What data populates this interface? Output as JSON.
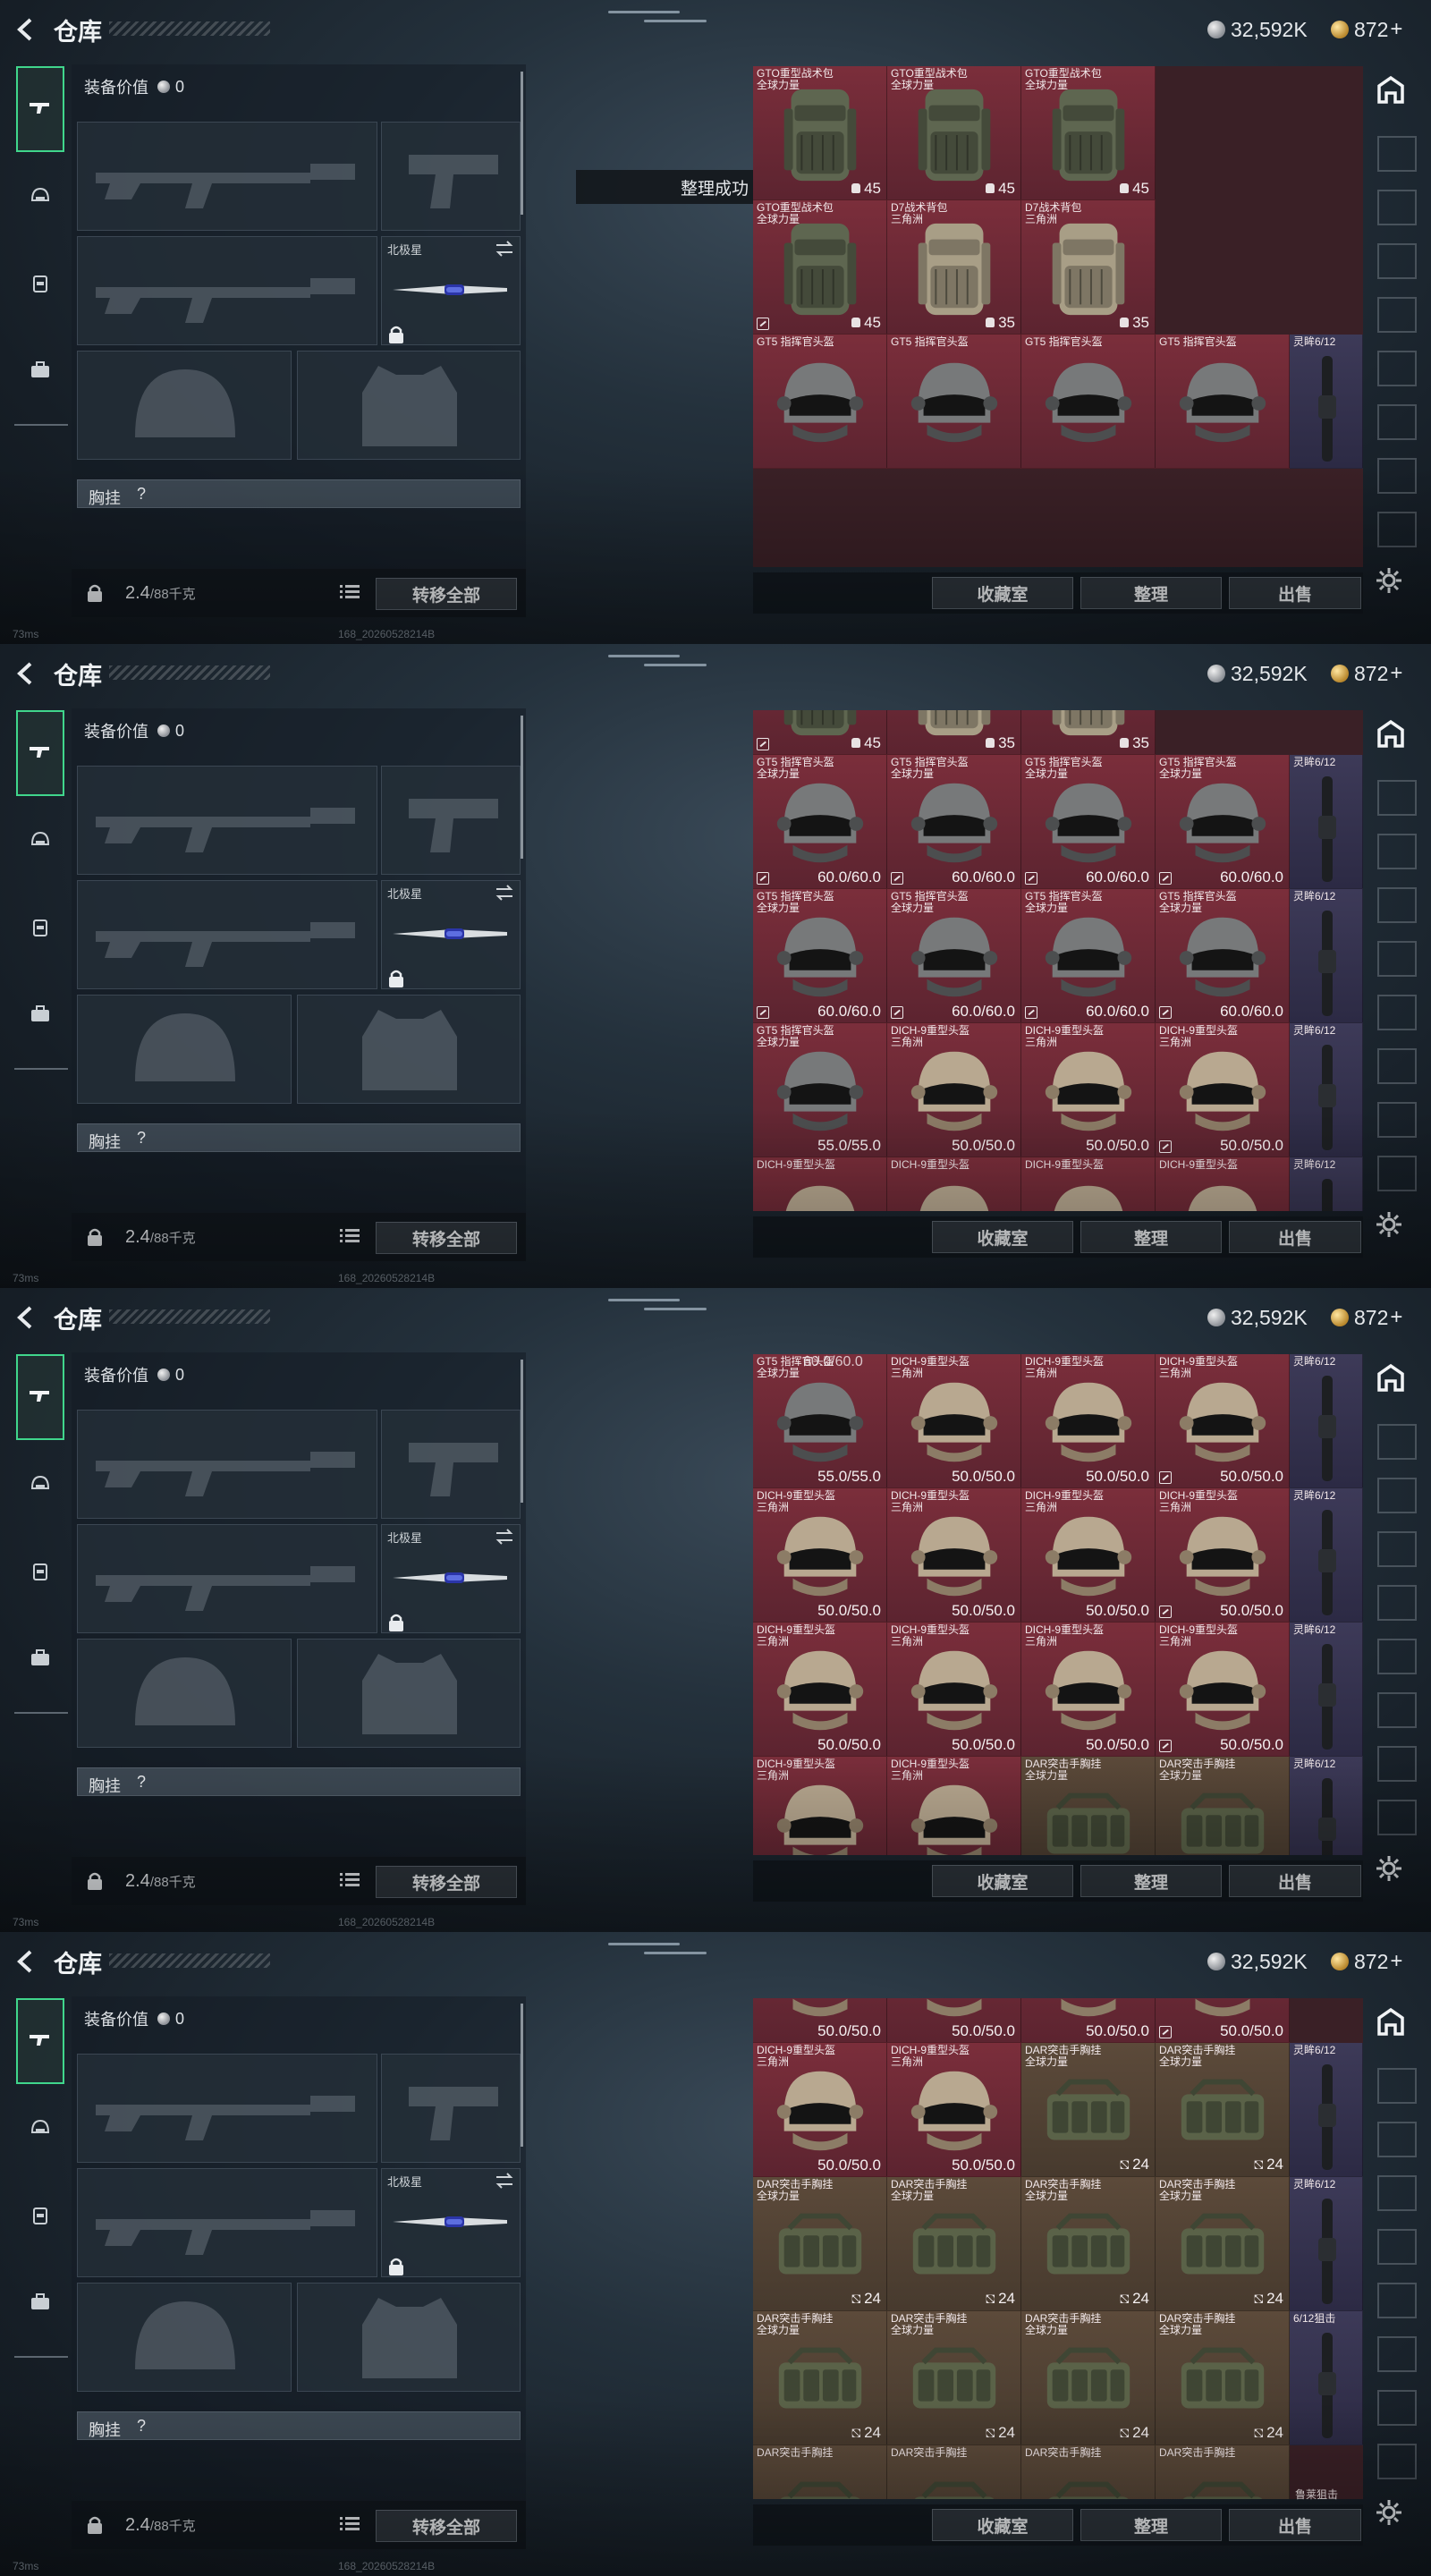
{
  "header": {
    "title": "仓库",
    "silver": "32,592K",
    "gold": "872",
    "gold_plus": "+"
  },
  "equipment": {
    "value_label": "装备价值",
    "value": "0",
    "melee_label": "北极星",
    "chest_label": "胸挂",
    "chest_q": "?",
    "weight": "2.4",
    "weight_cap": "/88千克",
    "transfer_all": "转移全部"
  },
  "toast": "整理成功",
  "actions": {
    "collection": "收藏室",
    "sort": "整理",
    "sell": "出售"
  },
  "status": {
    "ping": "73ms",
    "build": "168_20260528214B"
  },
  "frames": [
    {
      "cells": [
        {
          "r": 0,
          "c": 0,
          "name": "GTO重型战术包",
          "sub": "全球力量",
          "value": "45",
          "kind": "pack-green",
          "val": "cap"
        },
        {
          "r": 0,
          "c": 1,
          "name": "GTO重型战术包",
          "sub": "全球力量",
          "value": "45",
          "kind": "pack-green",
          "val": "cap"
        },
        {
          "r": 0,
          "c": 2,
          "name": "GTO重型战术包",
          "sub": "全球力量",
          "value": "45",
          "kind": "pack-green",
          "val": "cap"
        },
        {
          "r": 1,
          "c": 0,
          "name": "GTO重型战术包",
          "sub": "全球力量",
          "value": "45",
          "kind": "pack-green",
          "val": "cap",
          "tag": true
        },
        {
          "r": 1,
          "c": 1,
          "name": "D7战术背包",
          "sub": "三角洲",
          "value": "35",
          "kind": "pack-tan",
          "val": "cap"
        },
        {
          "r": 1,
          "c": 2,
          "name": "D7战术背包",
          "sub": "三角洲",
          "value": "35",
          "kind": "pack-tan",
          "val": "cap"
        },
        {
          "r": 2,
          "c": 0,
          "name": "GT5 指挥官头盔",
          "sub": "",
          "value": "",
          "kind": "helmet-grey",
          "val": "",
          "narrowCol": false
        },
        {
          "r": 2,
          "c": 1,
          "name": "GT5 指挥官头盔",
          "sub": "",
          "value": "",
          "kind": "helmet-grey",
          "val": ""
        },
        {
          "r": 2,
          "c": 2,
          "name": "GT5 指挥官头盔",
          "sub": "",
          "value": "",
          "kind": "helmet-grey",
          "val": ""
        },
        {
          "r": 2,
          "c": 3,
          "name": "GT5 指挥官头盔",
          "sub": "",
          "value": "",
          "kind": "helmet-grey",
          "val": ""
        }
      ],
      "narrow": [
        {
          "r": 2,
          "name": "灵眸6/12"
        }
      ],
      "offset": 0,
      "layout": "packs"
    },
    {
      "cells": [
        {
          "r": 0,
          "c": 0,
          "name": "",
          "sub": "",
          "value": "45",
          "kind": "pack-green",
          "val": "cap",
          "tag": true
        },
        {
          "r": 0,
          "c": 1,
          "name": "",
          "sub": "",
          "value": "35",
          "kind": "pack-tan",
          "val": "cap"
        },
        {
          "r": 0,
          "c": 2,
          "name": "",
          "sub": "",
          "value": "35",
          "kind": "pack-tan",
          "val": "cap"
        },
        {
          "r": 1,
          "c": 0,
          "name": "GT5 指挥官头盔",
          "sub": "全球力量",
          "value": "60.0/60.0",
          "kind": "helmet-grey",
          "tag": true
        },
        {
          "r": 1,
          "c": 1,
          "name": "GT5 指挥官头盔",
          "sub": "全球力量",
          "value": "60.0/60.0",
          "kind": "helmet-grey",
          "tag": true
        },
        {
          "r": 1,
          "c": 2,
          "name": "GT5 指挥官头盔",
          "sub": "全球力量",
          "value": "60.0/60.0",
          "kind": "helmet-grey",
          "tag": true
        },
        {
          "r": 1,
          "c": 3,
          "name": "GT5 指挥官头盔",
          "sub": "全球力量",
          "value": "60.0/60.0",
          "kind": "helmet-grey",
          "tag": true
        },
        {
          "r": 2,
          "c": 0,
          "name": "GT5 指挥官头盔",
          "sub": "全球力量",
          "value": "60.0/60.0",
          "kind": "helmet-grey",
          "tag": true
        },
        {
          "r": 2,
          "c": 1,
          "name": "GT5 指挥官头盔",
          "sub": "全球力量",
          "value": "60.0/60.0",
          "kind": "helmet-grey",
          "tag": true
        },
        {
          "r": 2,
          "c": 2,
          "name": "GT5 指挥官头盔",
          "sub": "全球力量",
          "value": "60.0/60.0",
          "kind": "helmet-grey",
          "tag": true
        },
        {
          "r": 2,
          "c": 3,
          "name": "GT5 指挥官头盔",
          "sub": "全球力量",
          "value": "60.0/60.0",
          "kind": "helmet-grey",
          "tag": true
        },
        {
          "r": 3,
          "c": 0,
          "name": "GT5 指挥官头盔",
          "sub": "全球力量",
          "value": "55.0/55.0",
          "kind": "helmet-grey"
        },
        {
          "r": 3,
          "c": 1,
          "name": "DICH-9重型头盔",
          "sub": "三角洲",
          "value": "50.0/50.0",
          "kind": "helmet-tan"
        },
        {
          "r": 3,
          "c": 2,
          "name": "DICH-9重型头盔",
          "sub": "三角洲",
          "value": "50.0/50.0",
          "kind": "helmet-tan"
        },
        {
          "r": 3,
          "c": 3,
          "name": "DICH-9重型头盔",
          "sub": "三角洲",
          "value": "50.0/50.0",
          "kind": "helmet-tan",
          "tag": true
        },
        {
          "r": 4,
          "c": 0,
          "name": "DICH-9重型头盔",
          "sub": "",
          "value": "",
          "kind": "helmet-tan"
        },
        {
          "r": 4,
          "c": 1,
          "name": "DICH-9重型头盔",
          "sub": "",
          "value": "",
          "kind": "helmet-tan"
        },
        {
          "r": 4,
          "c": 2,
          "name": "DICH-9重型头盔",
          "sub": "",
          "value": "",
          "kind": "helmet-tan"
        },
        {
          "r": 4,
          "c": 3,
          "name": "DICH-9重型头盔",
          "sub": "",
          "value": "",
          "kind": "helmet-tan"
        }
      ],
      "narrow": [
        {
          "r": 1,
          "name": "灵眸6/12"
        },
        {
          "r": 2,
          "name": "灵眸6/12"
        },
        {
          "r": 3,
          "name": "灵眸6/12"
        },
        {
          "r": 4,
          "name": "灵眸6/12"
        }
      ],
      "offset": -100,
      "layout": "helmets"
    },
    {
      "cells": [
        {
          "r": 0,
          "c": 0,
          "name": "GT5 指挥官头盔",
          "sub": "全球力量",
          "value": "55.0/55.0",
          "kind": "helmet-grey"
        },
        {
          "r": 0,
          "c": 1,
          "name": "DICH-9重型头盔",
          "sub": "三角洲",
          "value": "50.0/50.0",
          "kind": "helmet-tan"
        },
        {
          "r": 0,
          "c": 2,
          "name": "DICH-9重型头盔",
          "sub": "三角洲",
          "value": "50.0/50.0",
          "kind": "helmet-tan"
        },
        {
          "r": 0,
          "c": 3,
          "name": "DICH-9重型头盔",
          "sub": "三角洲",
          "value": "50.0/50.0",
          "kind": "helmet-tan",
          "tag": true
        },
        {
          "r": 1,
          "c": 0,
          "name": "DICH-9重型头盔",
          "sub": "三角洲",
          "value": "50.0/50.0",
          "kind": "helmet-tan"
        },
        {
          "r": 1,
          "c": 1,
          "name": "DICH-9重型头盔",
          "sub": "三角洲",
          "value": "50.0/50.0",
          "kind": "helmet-tan"
        },
        {
          "r": 1,
          "c": 2,
          "name": "DICH-9重型头盔",
          "sub": "三角洲",
          "value": "50.0/50.0",
          "kind": "helmet-tan"
        },
        {
          "r": 1,
          "c": 3,
          "name": "DICH-9重型头盔",
          "sub": "三角洲",
          "value": "50.0/50.0",
          "kind": "helmet-tan",
          "tag": true
        },
        {
          "r": 2,
          "c": 0,
          "name": "DICH-9重型头盔",
          "sub": "三角洲",
          "value": "50.0/50.0",
          "kind": "helmet-tan"
        },
        {
          "r": 2,
          "c": 1,
          "name": "DICH-9重型头盔",
          "sub": "三角洲",
          "value": "50.0/50.0",
          "kind": "helmet-tan"
        },
        {
          "r": 2,
          "c": 2,
          "name": "DICH-9重型头盔",
          "sub": "三角洲",
          "value": "50.0/50.0",
          "kind": "helmet-tan"
        },
        {
          "r": 2,
          "c": 3,
          "name": "DICH-9重型头盔",
          "sub": "三角洲",
          "value": "50.0/50.0",
          "kind": "helmet-tan",
          "tag": true
        },
        {
          "r": 3,
          "c": 0,
          "name": "DICH-9重型头盔",
          "sub": "三角洲",
          "value": "",
          "kind": "helmet-tan"
        },
        {
          "r": 3,
          "c": 1,
          "name": "DICH-9重型头盔",
          "sub": "三角洲",
          "value": "",
          "kind": "helmet-tan"
        },
        {
          "r": 3,
          "c": 2,
          "name": "DAR突击手胸挂",
          "sub": "全球力量",
          "value": "",
          "kind": "rig",
          "tan": true
        },
        {
          "r": 3,
          "c": 3,
          "name": "DAR突击手胸挂",
          "sub": "全球力量",
          "value": "",
          "kind": "rig",
          "tan": true
        }
      ],
      "narrow": [
        {
          "r": 0,
          "name": "灵眸6/12"
        },
        {
          "r": 1,
          "name": "灵眸6/12"
        },
        {
          "r": 2,
          "name": "灵眸6/12"
        },
        {
          "r": 3,
          "name": "灵眸6/12"
        }
      ],
      "offset": 0,
      "layout": "helmets2",
      "topValue": "60.0/60.0"
    },
    {
      "cells": [
        {
          "r": 0,
          "c": 0,
          "name": "",
          "sub": "",
          "value": "50.0/50.0",
          "kind": "helmet-tan"
        },
        {
          "r": 0,
          "c": 1,
          "name": "",
          "sub": "",
          "value": "50.0/50.0",
          "kind": "helmet-tan"
        },
        {
          "r": 0,
          "c": 2,
          "name": "",
          "sub": "",
          "value": "50.0/50.0",
          "kind": "helmet-tan"
        },
        {
          "r": 0,
          "c": 3,
          "name": "",
          "sub": "",
          "value": "50.0/50.0",
          "kind": "helmet-tan",
          "tag": true
        },
        {
          "r": 1,
          "c": 0,
          "name": "DICH-9重型头盔",
          "sub": "三角洲",
          "value": "50.0/50.0",
          "kind": "helmet-tan"
        },
        {
          "r": 1,
          "c": 1,
          "name": "DICH-9重型头盔",
          "sub": "三角洲",
          "value": "50.0/50.0",
          "kind": "helmet-tan"
        },
        {
          "r": 1,
          "c": 2,
          "name": "DAR突击手胸挂",
          "sub": "全球力量",
          "value": "24",
          "kind": "rig",
          "val": "res",
          "tan": true
        },
        {
          "r": 1,
          "c": 3,
          "name": "DAR突击手胸挂",
          "sub": "全球力量",
          "value": "24",
          "kind": "rig",
          "val": "res",
          "tan": true
        },
        {
          "r": 2,
          "c": 0,
          "name": "DAR突击手胸挂",
          "sub": "全球力量",
          "value": "24",
          "kind": "rig",
          "val": "res",
          "tan": true
        },
        {
          "r": 2,
          "c": 1,
          "name": "DAR突击手胸挂",
          "sub": "全球力量",
          "value": "24",
          "kind": "rig",
          "val": "res",
          "tan": true
        },
        {
          "r": 2,
          "c": 2,
          "name": "DAR突击手胸挂",
          "sub": "全球力量",
          "value": "24",
          "kind": "rig",
          "val": "res",
          "tan": true
        },
        {
          "r": 2,
          "c": 3,
          "name": "DAR突击手胸挂",
          "sub": "全球力量",
          "value": "24",
          "kind": "rig",
          "val": "res",
          "tan": true
        },
        {
          "r": 3,
          "c": 0,
          "name": "DAR突击手胸挂",
          "sub": "全球力量",
          "value": "24",
          "kind": "rig",
          "val": "res",
          "tan": true
        },
        {
          "r": 3,
          "c": 1,
          "name": "DAR突击手胸挂",
          "sub": "全球力量",
          "value": "24",
          "kind": "rig",
          "val": "res",
          "tan": true
        },
        {
          "r": 3,
          "c": 2,
          "name": "DAR突击手胸挂",
          "sub": "全球力量",
          "value": "24",
          "kind": "rig",
          "val": "res",
          "tan": true
        },
        {
          "r": 3,
          "c": 3,
          "name": "DAR突击手胸挂",
          "sub": "全球力量",
          "value": "24",
          "kind": "rig",
          "val": "res",
          "tan": true
        },
        {
          "r": 4,
          "c": 0,
          "name": "DAR突击手胸挂",
          "sub": "",
          "value": "",
          "kind": "rig",
          "tan": true
        },
        {
          "r": 4,
          "c": 1,
          "name": "DAR突击手胸挂",
          "sub": "",
          "value": "",
          "kind": "rig",
          "tan": true
        },
        {
          "r": 4,
          "c": 2,
          "name": "DAR突击手胸挂",
          "sub": "",
          "value": "",
          "kind": "rig",
          "tan": true
        },
        {
          "r": 4,
          "c": 3,
          "name": "DAR突击手胸挂",
          "sub": "",
          "value": "",
          "kind": "rig",
          "tan": true
        }
      ],
      "narrow": [
        {
          "r": 1,
          "name": "灵眸6/12"
        },
        {
          "r": 2,
          "name": "灵眸6/12"
        },
        {
          "r": 3,
          "name": "6/12狙击"
        }
      ],
      "offset": -100,
      "layout": "rigs",
      "narrowBottom": "鲁莱狙击"
    }
  ]
}
